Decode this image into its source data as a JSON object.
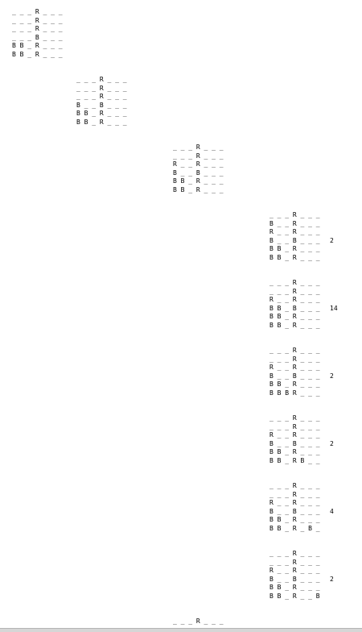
{
  "boards": [
    {
      "rows": [
        "_ _ _ R _ _ _",
        "_ _ _ R _ _ _",
        "_ _ _ R _ _ _",
        "_ _ _ B _ _ _",
        "B B _ R _ _ _",
        "B B _ R _ _ _"
      ]
    },
    {
      "rows": [
        "_ _ _ R _ _ _",
        "_ _ _ R _ _ _",
        "_ _ _ R _ _ _",
        "B _ _ B _ _ _",
        "B B _ R _ _ _",
        "B B _ R _ _ _"
      ]
    },
    {
      "rows": [
        "_ _ _ R _ _ _",
        "_ _ _ R _ _ _",
        "R _ _ R _ _ _",
        "B _ _ B _ _ _",
        "B B _ R _ _ _",
        "B B _ R _ _ _"
      ]
    },
    {
      "rows": [
        "_ _ _ R _ _ _",
        "B _ _ R _ _ _",
        "R _ _ R _ _ _",
        "B _ _ B _ _ _",
        "B B _ R _ _ _",
        "B B _ R _ _ _"
      ],
      "score": "2"
    },
    {
      "rows": [
        "_ _ _ R _ _ _",
        "_ _ _ R _ _ _",
        "R _ _ R _ _ _",
        "B B _ B _ _ _",
        "B B _ R _ _ _",
        "B B _ R _ _ _"
      ],
      "score": "14"
    },
    {
      "rows": [
        "_ _ _ R _ _ _",
        "_ _ _ R _ _ _",
        "R _ _ R _ _ _",
        "B _ _ B _ _ _",
        "B B _ R _ _ _",
        "B B B R _ _ _"
      ],
      "score": "2"
    },
    {
      "rows": [
        "_ _ _ R _ _ _",
        "_ _ _ R _ _ _",
        "R _ _ R _ _ _",
        "B _ _ B _ _ _",
        "B B _ R _ _ _",
        "B B _ R B _ _"
      ],
      "score": "2"
    },
    {
      "rows": [
        "_ _ _ R _ _ _",
        "_ _ _ R _ _ _",
        "R _ _ R _ _ _",
        "B _ _ B _ _ _",
        "B B _ R _ _ _",
        "B B _ R _ B _"
      ],
      "score": "4"
    },
    {
      "rows": [
        "_ _ _ R _ _ _",
        "_ _ _ R _ _ _",
        "R _ _ R _ _ _",
        "B _ _ B _ _ _",
        "B B _ R _ _ _",
        "B B _ R _ _ B"
      ],
      "score": "2"
    },
    {
      "rows": [
        "_ _ _ R _ _ _"
      ]
    }
  ]
}
